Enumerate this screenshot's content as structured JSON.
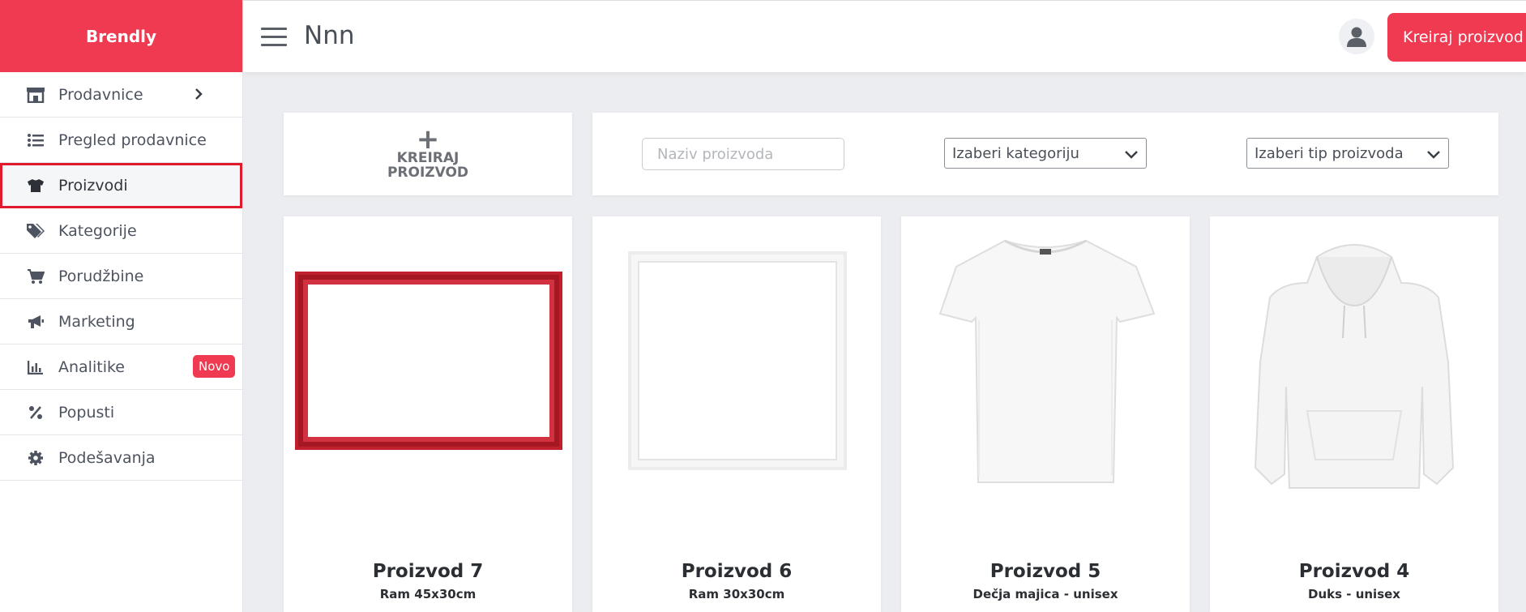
{
  "brand": "Brendly",
  "sidebar": {
    "items": [
      {
        "label": "Prodavnice",
        "icon": "store-icon"
      },
      {
        "label": "Pregled prodavnice",
        "icon": "list-icon"
      },
      {
        "label": "Proizvodi",
        "icon": "tshirt-icon"
      },
      {
        "label": "Kategorije",
        "icon": "tags-icon"
      },
      {
        "label": "Porudžbine",
        "icon": "cart-icon"
      },
      {
        "label": "Marketing",
        "icon": "megaphone-icon"
      },
      {
        "label": "Analitike",
        "icon": "chart-icon",
        "badge": "Novo"
      },
      {
        "label": "Popusti",
        "icon": "percent-icon"
      },
      {
        "label": "Podešavanja",
        "icon": "gear-icon"
      }
    ],
    "active_index": 2
  },
  "topbar": {
    "title": "Nnn",
    "create_button": "Kreiraj proizvod"
  },
  "toolbar": {
    "create_plus": "+",
    "create_label": "KREIRAJ PROIZVOD",
    "search_placeholder": "Naziv proizvoda",
    "category_select": "Izaberi kategoriju",
    "type_select": "Izaberi tip proizvoda"
  },
  "products": [
    {
      "name": "Proizvod 7",
      "desc": "Ram 45x30cm",
      "image": "red-frame"
    },
    {
      "name": "Proizvod 6",
      "desc": "Ram 30x30cm",
      "image": "white-frame"
    },
    {
      "name": "Proizvod 5",
      "desc": "Dečja majica - unisex",
      "image": "white-tshirt"
    },
    {
      "name": "Proizvod 4",
      "desc": "Duks - unisex",
      "image": "white-hoodie"
    }
  ],
  "colors": {
    "accent": "#ef3a51",
    "active_border": "#e01b2e",
    "background": "#ecedf0"
  }
}
